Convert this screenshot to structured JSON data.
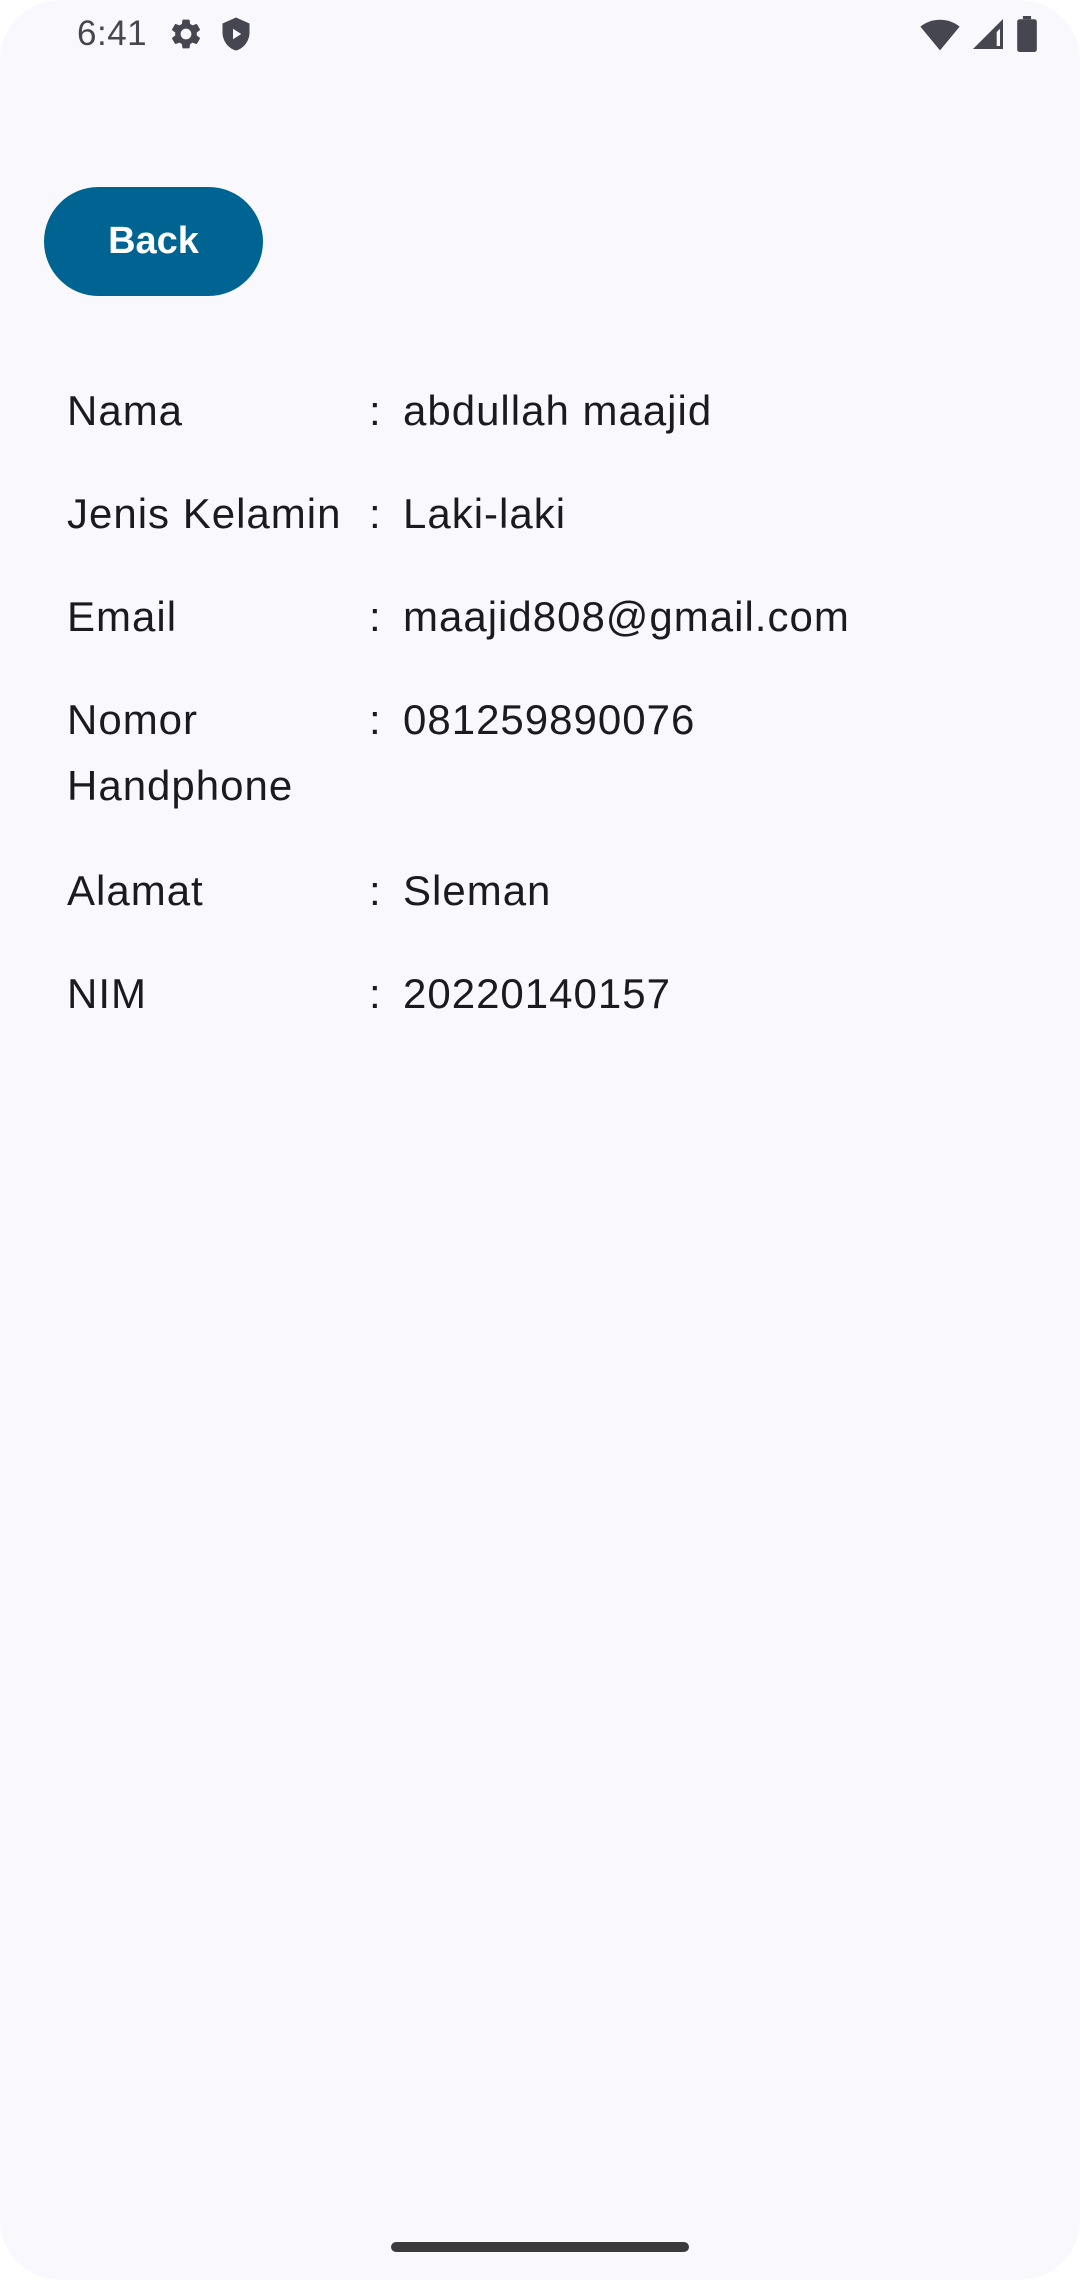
{
  "status_bar": {
    "time": "6:41",
    "left_icons": [
      "settings-icon",
      "shield-icon"
    ],
    "right_icons": [
      "wifi-icon",
      "signal-icon",
      "battery-icon"
    ]
  },
  "back_button": {
    "label": "Back",
    "color": "#006493"
  },
  "details": [
    {
      "label": "Nama",
      "separator": ":",
      "value": "abdullah maajid"
    },
    {
      "label": "Jenis Kelamin",
      "separator": ":",
      "value": "Laki-laki"
    },
    {
      "label": "Email",
      "separator": ":",
      "value": "maajid808@gmail.com"
    },
    {
      "label": "Nomor Handphone",
      "separator": ":",
      "value": "081259890076"
    },
    {
      "label": "Alamat",
      "separator": ":",
      "value": "Sleman"
    },
    {
      "label": "NIM",
      "separator": ":",
      "value": "20220140157"
    }
  ]
}
